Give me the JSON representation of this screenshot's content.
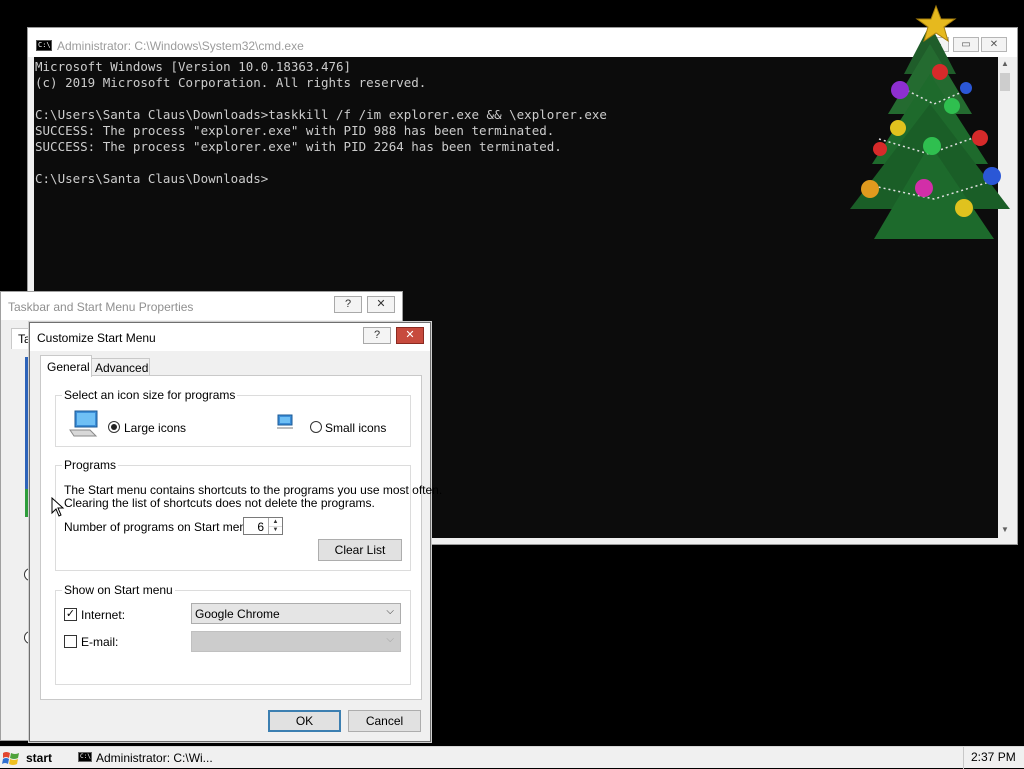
{
  "cmd": {
    "title": "Administrator: C:\\Windows\\System32\\cmd.exe",
    "icon_text": "C:\\",
    "minimize": "—",
    "maximize": "▭",
    "close": "✕",
    "lines": [
      "Microsoft Windows [Version 10.0.18363.476]",
      "(c) 2019 Microsoft Corporation. All rights reserved.",
      "",
      "C:\\Users\\Santa Claus\\Downloads>taskkill /f /im explorer.exe && \\explorer.exe",
      "SUCCESS: The process \"explorer.exe\" with PID 988 has been terminated.",
      "SUCCESS: The process \"explorer.exe\" with PID 2264 has been terminated.",
      "",
      "C:\\Users\\Santa Claus\\Downloads>"
    ]
  },
  "tsm": {
    "title": "Taskbar and Start Menu Properties",
    "help": "?",
    "close": "✕",
    "tab_stub": "Ta"
  },
  "csm": {
    "title": "Customize Start Menu",
    "help": "?",
    "close": "✕",
    "tabs": {
      "general": "General",
      "advanced": "Advanced"
    },
    "icon_size": {
      "legend": "Select an icon size for programs",
      "large": "Large icons",
      "small": "Small icons",
      "selected": "large"
    },
    "programs": {
      "legend": "Programs",
      "desc_line1": "The Start menu contains shortcuts to the programs you use most often.",
      "desc_line2": "Clearing the list of shortcuts does not delete the programs.",
      "count_label": "Number of programs on Start menu:",
      "count_value": "6",
      "clear_button": "Clear List"
    },
    "show": {
      "legend": "Show on Start menu",
      "internet_label": "Internet:",
      "internet_checked": "✓",
      "internet_value": "Google Chrome",
      "email_label": "E-mail:",
      "email_value": ""
    },
    "ok": "OK",
    "cancel": "Cancel"
  },
  "taskbar": {
    "start": "start",
    "task": "Administrator: C:\\Wi...",
    "clock": "2:37 PM"
  }
}
